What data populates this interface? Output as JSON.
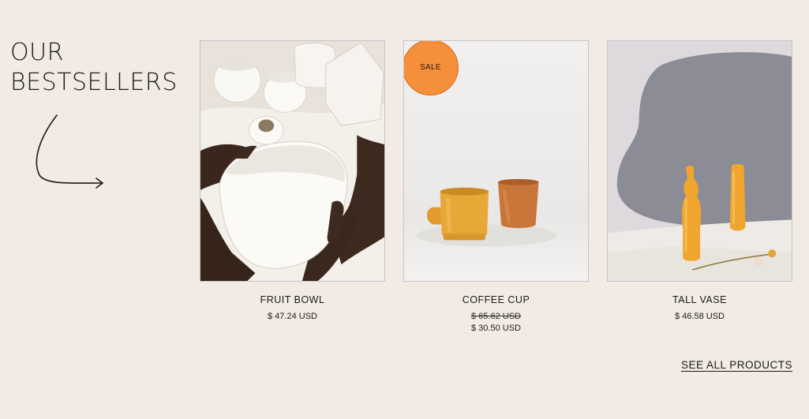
{
  "section": {
    "title_line1": "OUR",
    "title_line2": "BESTSELLERS"
  },
  "products": [
    {
      "name": "FRUIT BOWL",
      "price": "$ 47.24 USD"
    },
    {
      "name": "COFFEE CUP",
      "badge": "SALE",
      "old_price": "$ 65.62 USD",
      "price": "$ 30.50 USD"
    },
    {
      "name": "TALL VASE",
      "price": "$ 46.58 USD"
    }
  ],
  "see_all_label": "SEE ALL PRODUCTS",
  "colors": {
    "background": "#f2ebe4",
    "sale_badge": "#f58f3a",
    "cup_yellow": "#e8a838",
    "cup_terracotta": "#c9763a",
    "vase_yellow": "#f0a62e",
    "backdrop_gray": "#8c8c96"
  },
  "icons": {
    "arrow": "curved-arrow-icon"
  }
}
